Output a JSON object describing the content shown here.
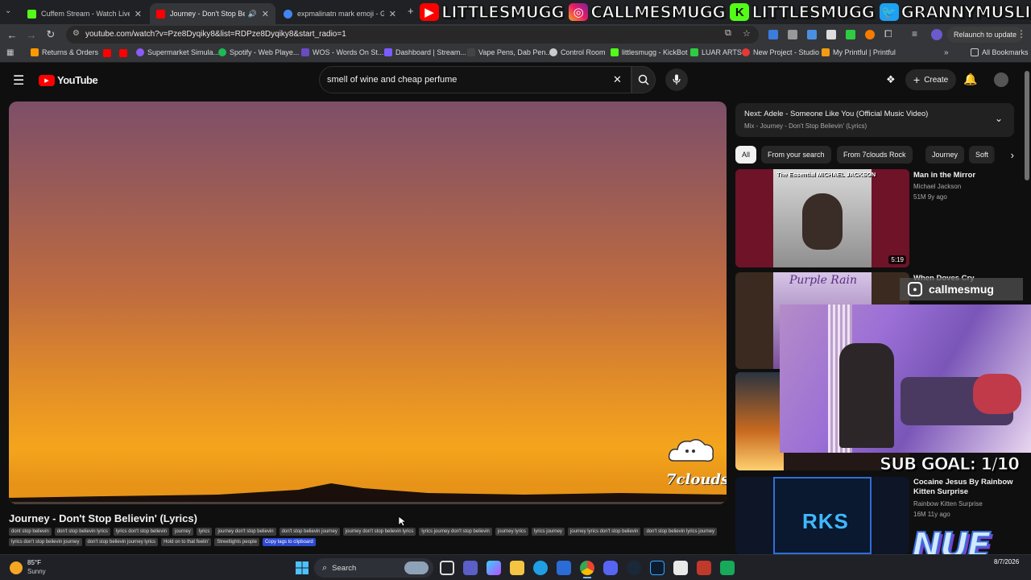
{
  "browser": {
    "tabs": [
      {
        "title": "Cuffem Stream - Watch Live on",
        "favicon_color": "#53fc18",
        "active": false
      },
      {
        "title": "Journey - Don't Stop Believi",
        "favicon_color": "#ff0000",
        "active": true
      },
      {
        "title": "expmalinatn mark emoji - Goog",
        "favicon_color": "#4285f4",
        "active": false
      }
    ],
    "url": "youtube.com/watch?v=Pze8Dyqiky8&list=RDPze8Dyqiky8&start_radio=1",
    "relaunch_label": "Relaunch to update",
    "bookmarks": [
      {
        "label": "Returns & Orders",
        "color": "#ff9900"
      },
      {
        "label": "Supermarket Simula...",
        "color": "#8a5cf6"
      },
      {
        "label": "Spotify - Web Playe...",
        "color": "#1db954"
      },
      {
        "label": "WOS - Words On St...",
        "color": "#6a4bc4"
      },
      {
        "label": "Dashboard | Stream...",
        "color": "#7b5cff"
      },
      {
        "label": "Vape Pens, Dab Pen...",
        "color": "#444444"
      },
      {
        "label": "Control Room",
        "color": "#cccccc"
      },
      {
        "label": "littlesmugg - KickBot",
        "color": "#53fc18"
      },
      {
        "label": "LUAR ARTS",
        "color": "#2ecc40"
      },
      {
        "label": "New Project - Studio",
        "color": "#e53935"
      },
      {
        "label": "My Printful | Printful",
        "color": "#f39c12"
      }
    ],
    "all_bookmarks_label": "All Bookmarks"
  },
  "stream_banner": {
    "items": [
      "LITTLESMUGG",
      "CALLMESMUGG",
      "LITTLESMUGG",
      "GRANNYMUSLIM"
    ]
  },
  "youtube": {
    "logo_text": "YouTube",
    "search_query": "smell of wine and cheap perfume",
    "create_label": "Create",
    "video_title": "Journey - Don't Stop Believin' (Lyrics)",
    "watermark": "7clouds",
    "tags": [
      "dont stop believin",
      "don't stop believin lyrics",
      "lyrics don't stop believin",
      "journey",
      "lyrics",
      "journey don't stop believin",
      "don't stop believin journey",
      "journey don't stop believin lyrics",
      "lyrics journey don't stop believin",
      "journey lyrics",
      "lyrics journey",
      "journey lyrics don't stop believin",
      "don't stop believin lyrics journey",
      "lyrics don't stop believin journey",
      "don't stop believin journey lyrics",
      "Hold on to that feelin'",
      "Streetlights people"
    ],
    "copy_tags_label": "Copy tags to clipboard",
    "next": {
      "title": "Next: Adele - Someone Like You (Official Music Video)",
      "subtitle": "Mix - Journey - Don't Stop Believin' (Lyrics)"
    },
    "chips": [
      "All",
      "From your search",
      "From 7clouds Rock",
      "Journey",
      "Soft"
    ],
    "recommendations": [
      {
        "title": "Man in the Mirror",
        "channel": "Michael Jackson",
        "meta": "51M  9y ago",
        "duration": "5:19",
        "thumb_label": "The Essential MICHAEL JACKSON"
      },
      {
        "title": "When Doves Cry",
        "channel": "",
        "meta": "",
        "duration": "",
        "thumb_label": "Purple Rain"
      },
      {
        "title": "Cocaine Jesus By Rainbow Kitten Surprise",
        "channel": "Rainbow Kitten Surprise",
        "meta": "16M  11y ago",
        "duration": "",
        "thumb_label": "RKS"
      }
    ]
  },
  "overlay": {
    "instagram_handle": "callmesmug",
    "sub_goal": "SUB GOAL: 1/10",
    "nue_logo": "NUE"
  },
  "taskbar": {
    "weather_temp": "85°F",
    "weather_desc": "Sunny",
    "search_label": "Search",
    "date": "8/7/2026"
  }
}
